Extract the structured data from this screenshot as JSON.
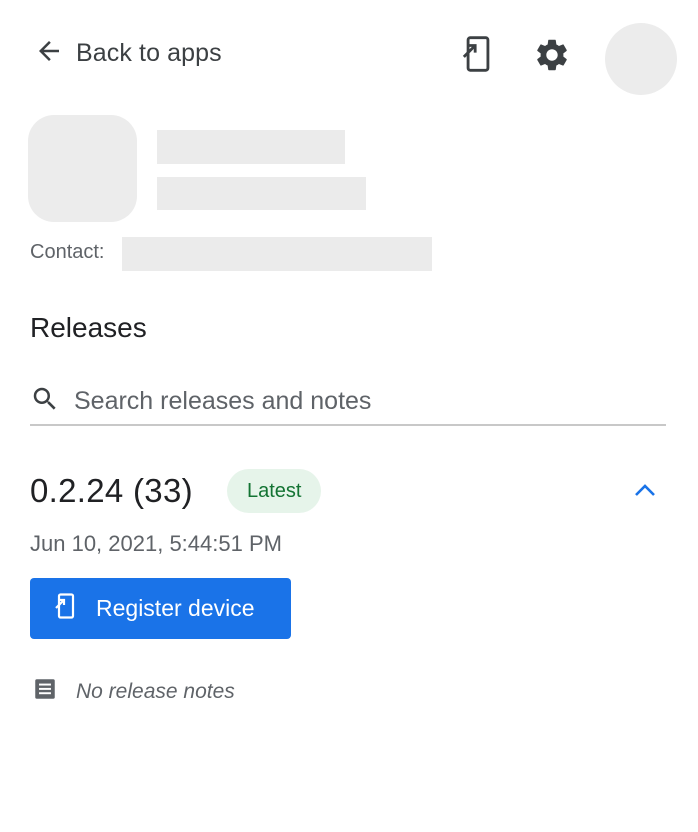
{
  "topbar": {
    "back_label": "Back to apps",
    "back_icon": "arrow-left-icon",
    "device_icon": "device-register-icon",
    "settings_icon": "gear-icon"
  },
  "app": {
    "contact_label": "Contact:"
  },
  "releases": {
    "title": "Releases",
    "search_placeholder": "Search releases and notes",
    "search_value": "",
    "items": [
      {
        "version": "0.2.24 (33)",
        "badge": "Latest",
        "timestamp": "Jun 10, 2021, 5:44:51 PM",
        "register_label": "Register device",
        "notes": "No release notes"
      }
    ]
  },
  "colors": {
    "primary": "#1a73e8",
    "badge_bg": "#e6f4ea",
    "badge_text": "#137333",
    "placeholder_gray": "#ececec"
  }
}
